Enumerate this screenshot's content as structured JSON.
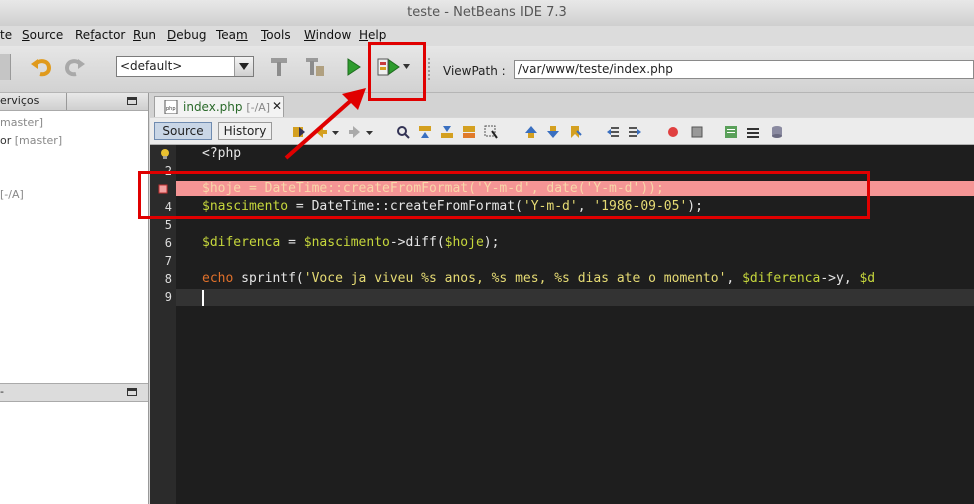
{
  "window": {
    "title": "teste - NetBeans IDE 7.3"
  },
  "menu": {
    "items": [
      {
        "pre": "",
        "u": "",
        "post": "te"
      },
      {
        "pre": "",
        "u": "S",
        "post": "ource"
      },
      {
        "pre": "Re",
        "u": "f",
        "post": "actor"
      },
      {
        "pre": "",
        "u": "R",
        "post": "un"
      },
      {
        "pre": "",
        "u": "D",
        "post": "ebug"
      },
      {
        "pre": "Tea",
        "u": "m",
        "post": ""
      },
      {
        "pre": "",
        "u": "T",
        "post": "ools"
      },
      {
        "pre": "",
        "u": "W",
        "post": "indow"
      },
      {
        "pre": "",
        "u": "H",
        "post": "elp"
      }
    ]
  },
  "toolbar": {
    "config_value": "<default>",
    "viewpath_label": "ViewPath :",
    "viewpath_value": "/var/www/teste/index.php"
  },
  "left_panel": {
    "header": "erviços",
    "tree": [
      {
        "text": "",
        "dim": "master]"
      },
      {
        "text": "or ",
        "dim": "[master]"
      },
      {
        "text": "",
        "dim": "[-/A]"
      }
    ]
  },
  "editor": {
    "file_tab": "index.php",
    "file_tab_status": "[-/A]",
    "source_tab": "Source",
    "history_tab": "History",
    "line_numbers": [
      "",
      "2",
      "",
      "4",
      "5",
      "6",
      "7",
      "8",
      "9"
    ],
    "lines": {
      "l1": "<?php",
      "l3a": "$hoje",
      "l3b": " = ",
      "l3c": "DateTime::createFromFormat(",
      "l3d": "'Y-m-d'",
      "l3e": ", date(",
      "l3f": "'Y-m-d'",
      "l3g": "));",
      "l4a": "$nascimento",
      "l4b": " = DateTime::createFromFormat(",
      "l4c": "'Y-m-d'",
      "l4d": ", ",
      "l4e": "'1986-09-05'",
      "l4f": ");",
      "l6a": "$diferenca",
      "l6b": " = ",
      "l6c": "$nascimento",
      "l6d": "->diff(",
      "l6e": "$hoje",
      "l6f": ");",
      "l8a": "echo",
      "l8b": " sprintf(",
      "l8c": "'Voce ja viveu %s anos, %s mes, %s dias ate o momento'",
      "l8d": ", ",
      "l8e": "$diferenca",
      "l8f": "->y, ",
      "l8g": "$d"
    }
  },
  "colors": {
    "accent_red": "#e00000",
    "editor_bg": "#1e1e1e",
    "error_highlight": "#f59595"
  }
}
